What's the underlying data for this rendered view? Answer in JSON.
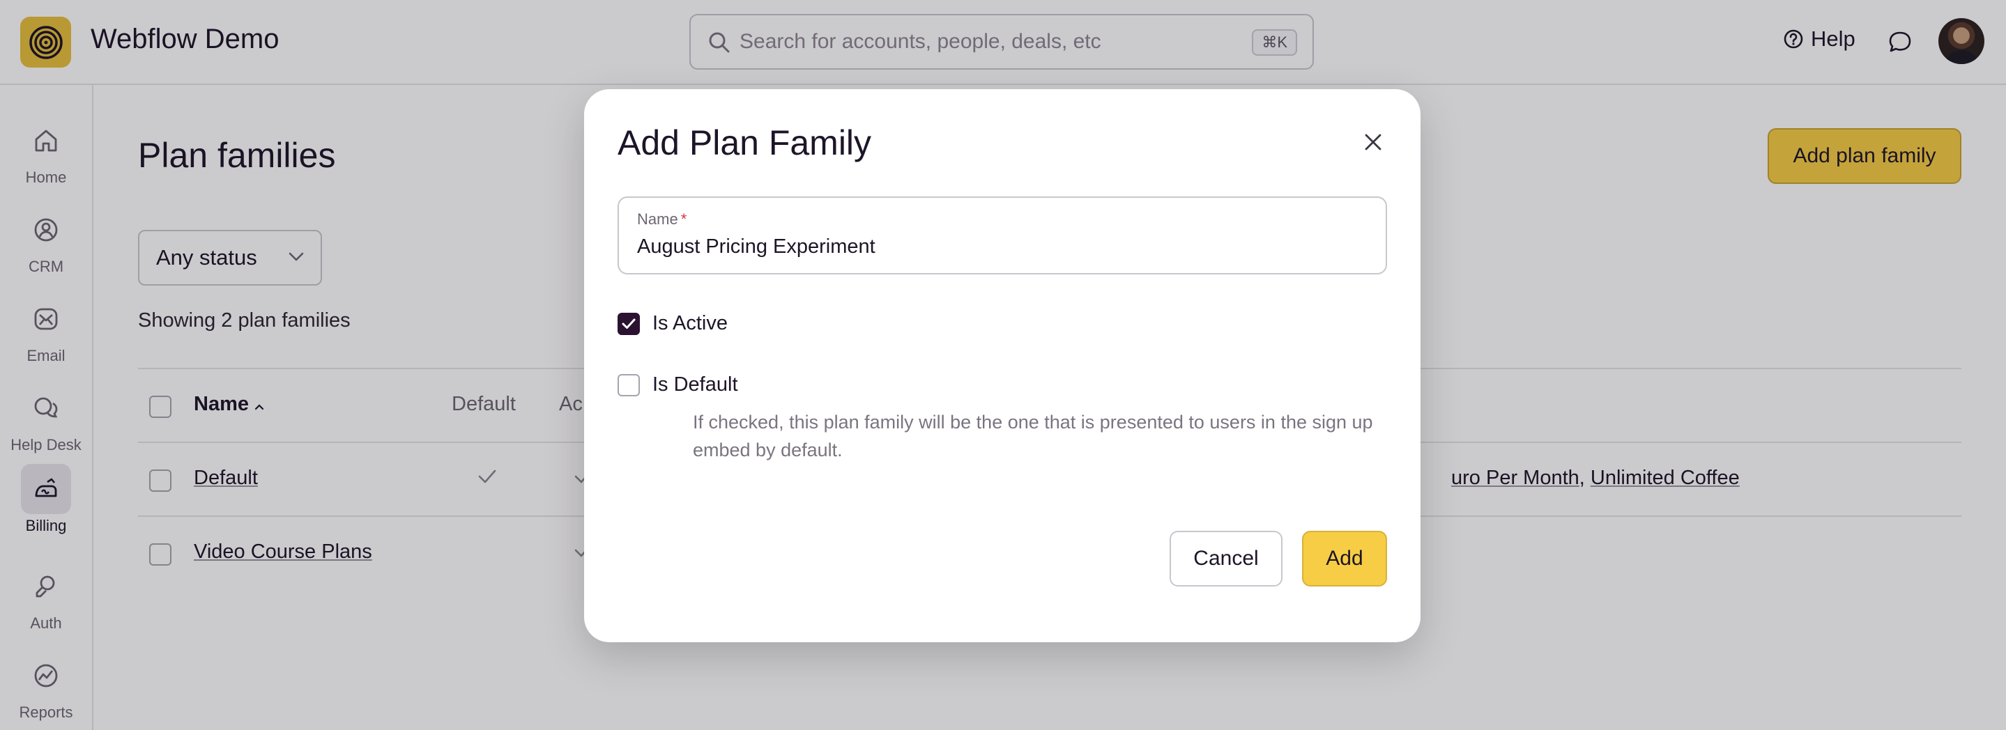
{
  "app": {
    "title": "Webflow Demo",
    "accent_color": "#f6cd44",
    "logo_icon": "spiral-logo"
  },
  "search": {
    "placeholder": "Search for accounts, people, deals, etc",
    "shortcut": "⌘K"
  },
  "topbar": {
    "help_label": "Help",
    "chat_icon": "chat-bubble-icon",
    "avatar": "user-avatar"
  },
  "sidebar": {
    "items": [
      {
        "label": "Home",
        "icon": "home-icon",
        "active": false
      },
      {
        "label": "CRM",
        "icon": "person-circle-icon",
        "active": false
      },
      {
        "label": "Email",
        "icon": "envelope-icon",
        "active": false
      },
      {
        "label": "Help Desk",
        "icon": "chat-bubbles-icon",
        "active": false
      },
      {
        "label": "Billing",
        "icon": "billing-icon",
        "active": true
      },
      {
        "label": "Auth",
        "icon": "auth-icon",
        "active": false
      },
      {
        "label": "Reports",
        "icon": "chart-icon",
        "active": false
      }
    ]
  },
  "main": {
    "page_title": "Plan families",
    "add_button": "Add plan family",
    "status_filter": "Any status",
    "showing_text": "Showing 2 plan families",
    "table": {
      "columns": [
        "Name",
        "Default",
        "Ac"
      ],
      "rows": [
        {
          "name": "Default",
          "default": true,
          "active": true,
          "plans_partial": "uro Per Month",
          "plans_extra": "Unlimited Coffee"
        },
        {
          "name": "Video Course Plans",
          "default": false,
          "active": true
        }
      ]
    }
  },
  "modal": {
    "title": "Add Plan Family",
    "name_label": "Name",
    "required_mark": "*",
    "name_value": "August Pricing Experiment",
    "is_active_label": "Is Active",
    "is_active_checked": true,
    "is_default_label": "Is Default",
    "is_default_checked": false,
    "is_default_help": "If checked, this plan family will be the one that is presented to users in the sign up embed by default.",
    "cancel_label": "Cancel",
    "add_label": "Add"
  }
}
